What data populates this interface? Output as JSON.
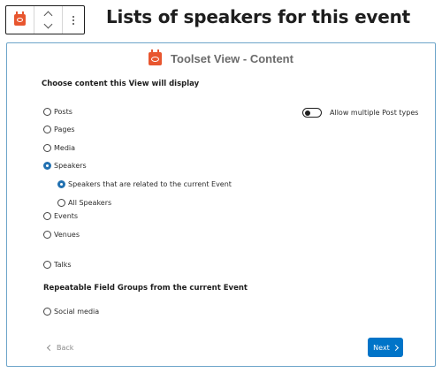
{
  "block_title": "Lists of speakers for this event",
  "panel": {
    "title": "Toolset View - Content",
    "choose_label": "Choose content this View will display",
    "toggle_label": "Allow multiple Post types",
    "options": [
      "Posts",
      "Pages",
      "Media",
      "Speakers",
      "Events",
      "Venues",
      "Talks"
    ],
    "selected_option": "Speakers",
    "sub_options": [
      "Speakers that are related to the current Event",
      "All Speakers"
    ],
    "selected_sub_option": "Speakers that are related to the current Event",
    "repeatable_label": "Repeatable Field Groups from the current Event",
    "repeatable_options": [
      "Social media"
    ],
    "back_label": "Back",
    "next_label": "Next"
  },
  "colors": {
    "accent": "#0074c8",
    "icon": "#e8562f",
    "panel_border": "#6da5c9"
  },
  "icons": {
    "block": "toolset-view-icon",
    "move": "chevron-up-down-icon",
    "more": "more-vertical-icon"
  }
}
